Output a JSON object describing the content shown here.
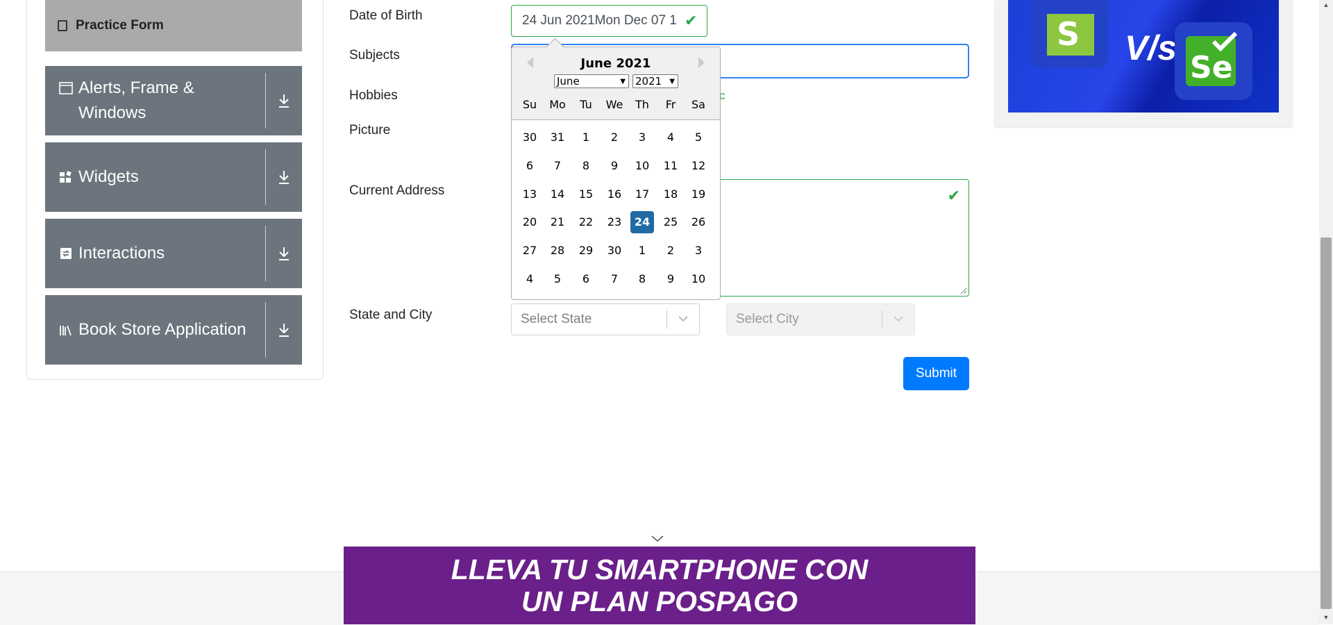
{
  "sidebar": {
    "practice_form": "Practice Form",
    "groups": [
      {
        "label": "Alerts, Frame & Windows"
      },
      {
        "label": "Widgets"
      },
      {
        "label": "Interactions"
      },
      {
        "label": "Book Store Application"
      }
    ]
  },
  "form": {
    "dob_label": "Date of Birth",
    "dob_value": "24 Jun 2021Mon Dec 07 1",
    "subjects_label": "Subjects",
    "hobbies_label": "Hobbies",
    "hobbies_tail": "c",
    "picture_label": "Picture",
    "address_label": "Current Address",
    "state_city_label": "State and City",
    "state_placeholder": "Select State",
    "city_placeholder": "Select City",
    "submit_label": "Submit"
  },
  "datepicker": {
    "title": "June 2021",
    "month_select": "June",
    "year_select": "2021",
    "day_names": [
      "Su",
      "Mo",
      "Tu",
      "We",
      "Th",
      "Fr",
      "Sa"
    ],
    "weeks": [
      [
        "30",
        "31",
        "1",
        "2",
        "3",
        "4",
        "5"
      ],
      [
        "6",
        "7",
        "8",
        "9",
        "10",
        "11",
        "12"
      ],
      [
        "13",
        "14",
        "15",
        "16",
        "17",
        "18",
        "19"
      ],
      [
        "20",
        "21",
        "22",
        "23",
        "24",
        "25",
        "26"
      ],
      [
        "27",
        "28",
        "29",
        "30",
        "1",
        "2",
        "3"
      ],
      [
        "4",
        "5",
        "6",
        "7",
        "8",
        "9",
        "10"
      ]
    ],
    "selected_day": "24"
  },
  "ads": {
    "top_vs": "V/s",
    "banner_line1": "LLEVA TU SMARTPHONE CON",
    "banner_line2": "UN PLAN POSPAGO"
  },
  "colors": {
    "valid": "#28a745",
    "primary": "#007bff",
    "sidebar_group": "#6c757d",
    "selected_day": "#216ba5",
    "banner": "#6b1f8a"
  }
}
